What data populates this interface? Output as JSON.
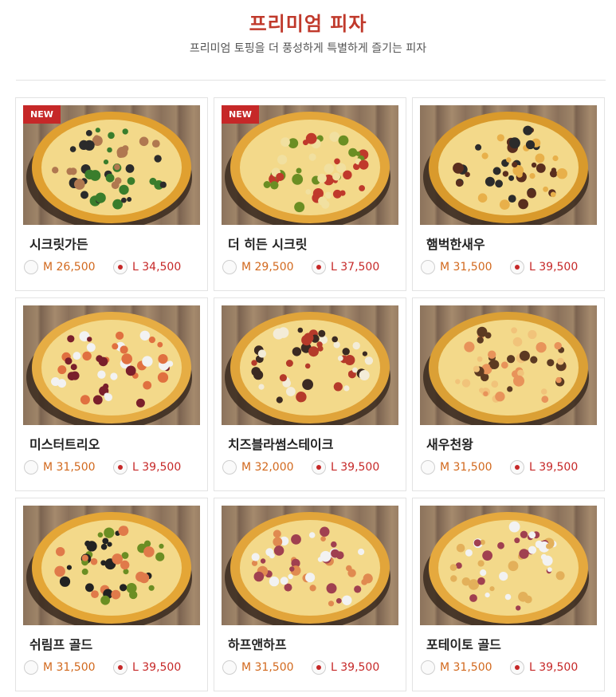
{
  "header": {
    "title": "프리미엄 피자",
    "subtitle": "프리미엄 토핑을 더 풍성하게 특별하게 즐기는 피자"
  },
  "colors": {
    "accent": "#c62828",
    "title": "#c0392b",
    "price_m": "#d2691e"
  },
  "pizzas": [
    {
      "name": "시크릿가든",
      "badge": "NEW",
      "price_m": "M 26,500",
      "price_l": "L 34,500",
      "selected": "L"
    },
    {
      "name": "더 히든 시크릿",
      "badge": "NEW",
      "price_m": "M 29,500",
      "price_l": "L 37,500",
      "selected": "L"
    },
    {
      "name": "햄벅한새우",
      "badge": "",
      "price_m": "M 31,500",
      "price_l": "L 39,500",
      "selected": "L"
    },
    {
      "name": "미스터트리오",
      "badge": "",
      "price_m": "M 31,500",
      "price_l": "L 39,500",
      "selected": "L"
    },
    {
      "name": "치즈블라썸스테이크",
      "badge": "",
      "price_m": "M 32,000",
      "price_l": "L 39,500",
      "selected": "L"
    },
    {
      "name": "새우천왕",
      "badge": "",
      "price_m": "M 31,500",
      "price_l": "L 39,500",
      "selected": "L"
    },
    {
      "name": "쉬림프 골드",
      "badge": "",
      "price_m": "M 31,500",
      "price_l": "L 39,500",
      "selected": "L"
    },
    {
      "name": "하프앤하프",
      "badge": "",
      "price_m": "M 31,500",
      "price_l": "L 39,500",
      "selected": "L"
    },
    {
      "name": "포테이토 골드",
      "badge": "",
      "price_m": "M 31,500",
      "price_l": "L 39,500",
      "selected": "L"
    }
  ]
}
